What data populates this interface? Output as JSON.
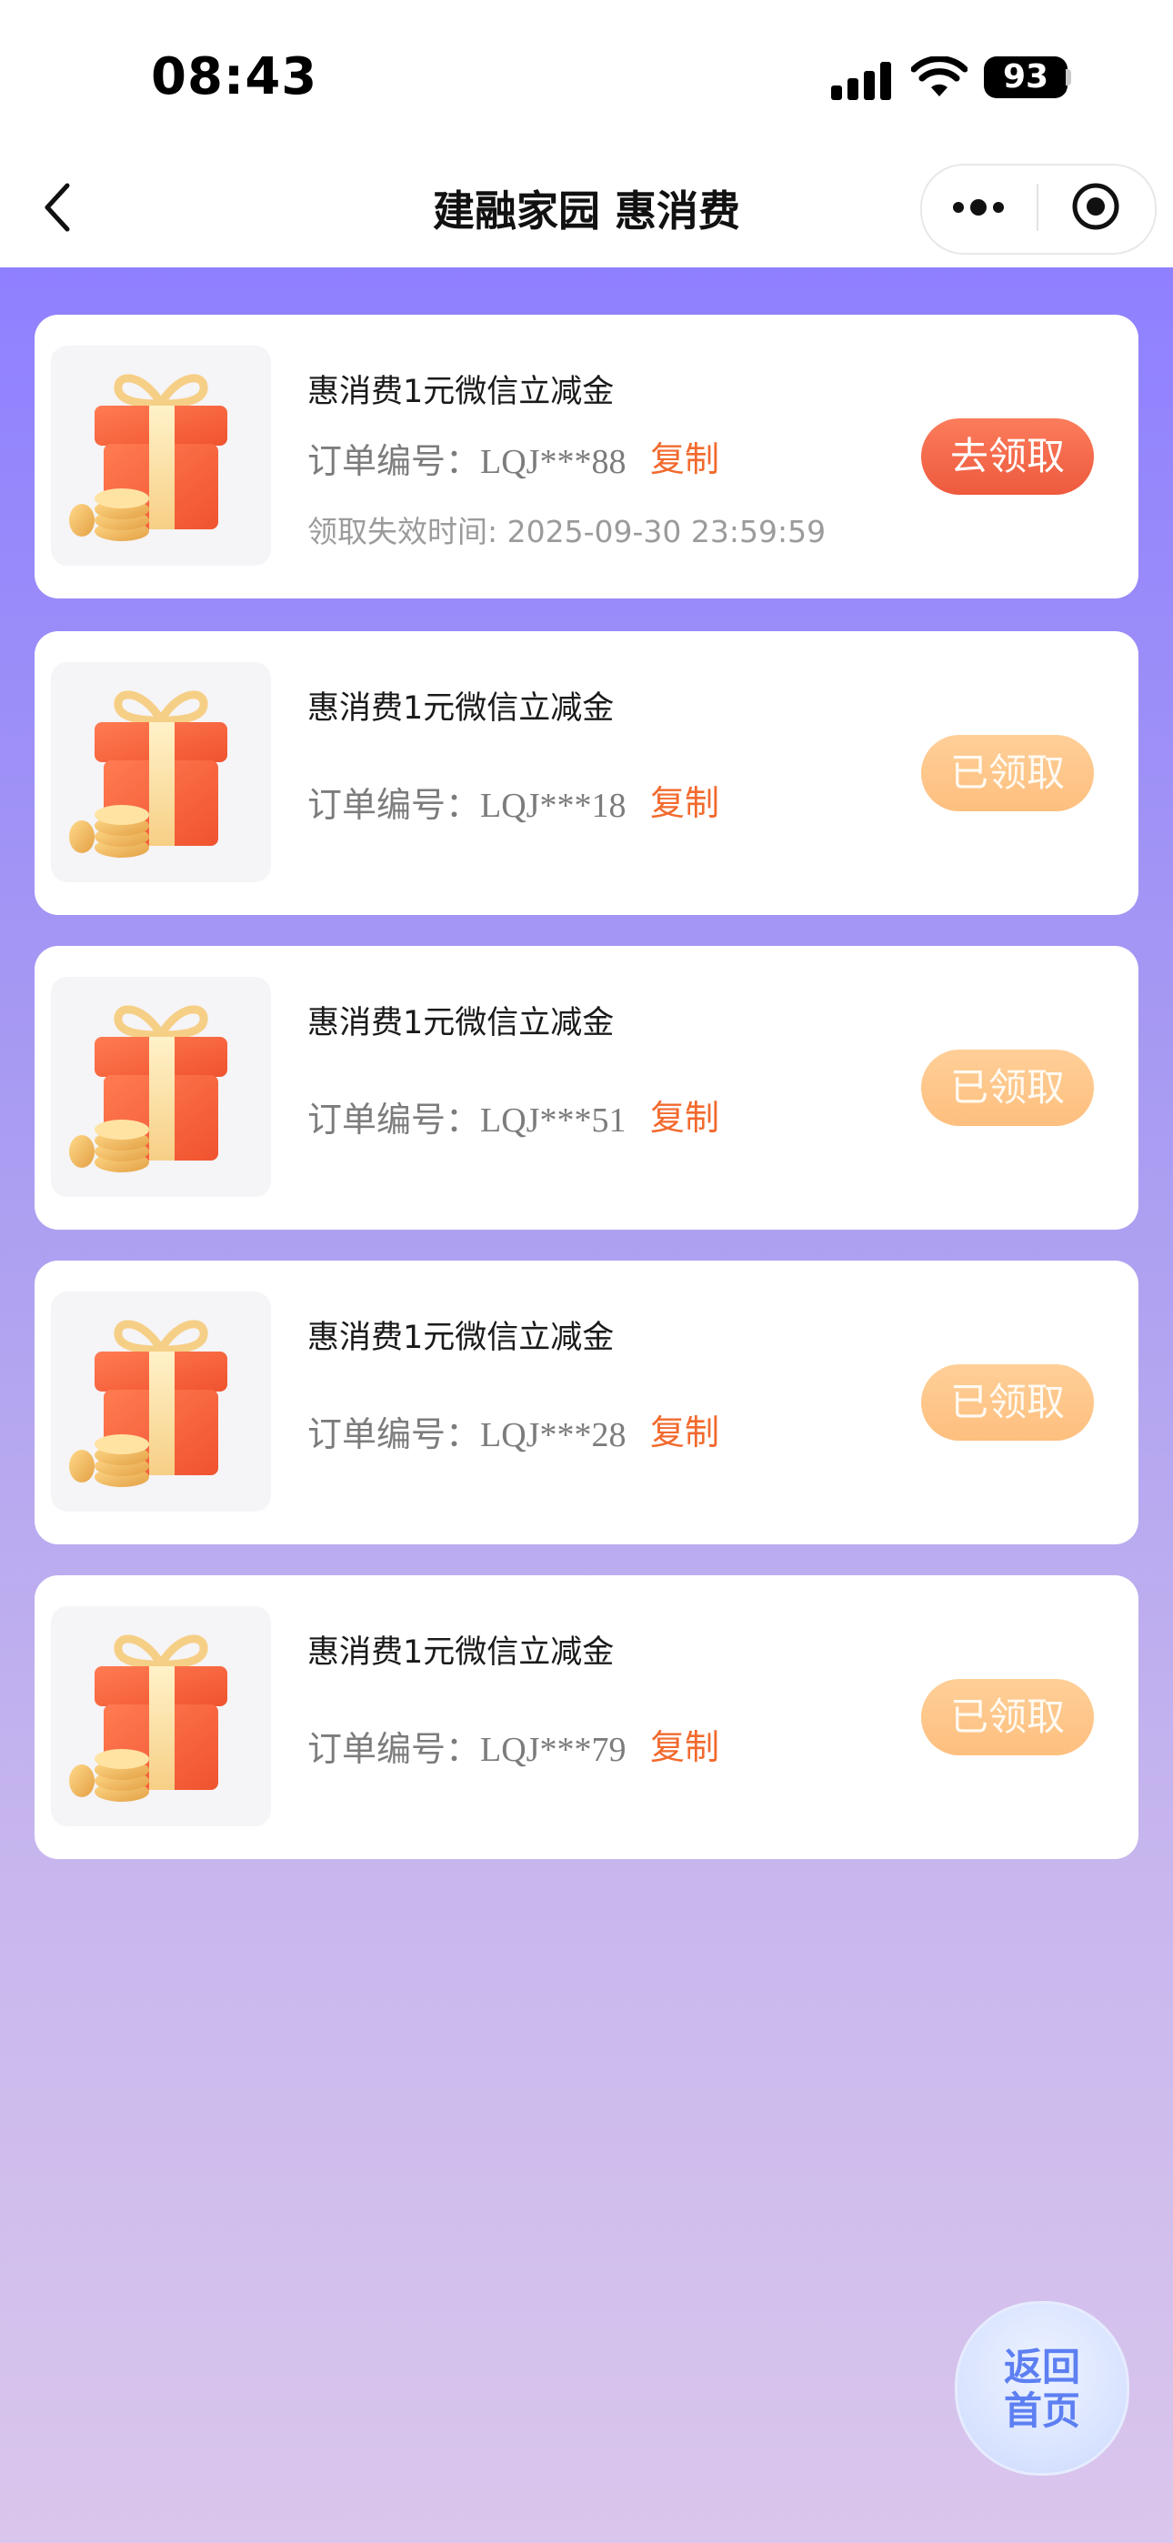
{
  "status_bar": {
    "time": "08:43",
    "battery": "93"
  },
  "nav": {
    "title": "建融家园 惠消费"
  },
  "cards": [
    {
      "title": "惠消费1元微信立减金",
      "order_label": "订单编号：",
      "order_no": "LQJ***88",
      "copy": "复制",
      "expire": "领取失效时间: 2025-09-30 23:59:59",
      "button": "去领取",
      "state": "active"
    },
    {
      "title": "惠消费1元微信立减金",
      "order_label": "订单编号：",
      "order_no": "LQJ***18",
      "copy": "复制",
      "button": "已领取",
      "state": "claimed"
    },
    {
      "title": "惠消费1元微信立减金",
      "order_label": "订单编号：",
      "order_no": "LQJ***51",
      "copy": "复制",
      "button": "已领取",
      "state": "claimed"
    },
    {
      "title": "惠消费1元微信立减金",
      "order_label": "订单编号：",
      "order_no": "LQJ***28",
      "copy": "复制",
      "button": "已领取",
      "state": "claimed"
    },
    {
      "title": "惠消费1元微信立减金",
      "order_label": "订单编号：",
      "order_no": "LQJ***79",
      "copy": "复制",
      "button": "已领取",
      "state": "claimed"
    }
  ],
  "home_button": {
    "line1": "返回",
    "line2": "首页"
  },
  "colors": {
    "accent": "#f26a2e",
    "active_button": "#ee5a3e",
    "claimed_button": "#fdbf7e",
    "bg_top": "#8f80ff",
    "bg_bottom": "#dac6ec"
  },
  "icons": [
    "back-icon",
    "more-icon",
    "target-icon",
    "gift-icon",
    "signal-icon",
    "wifi-icon",
    "battery-icon"
  ]
}
